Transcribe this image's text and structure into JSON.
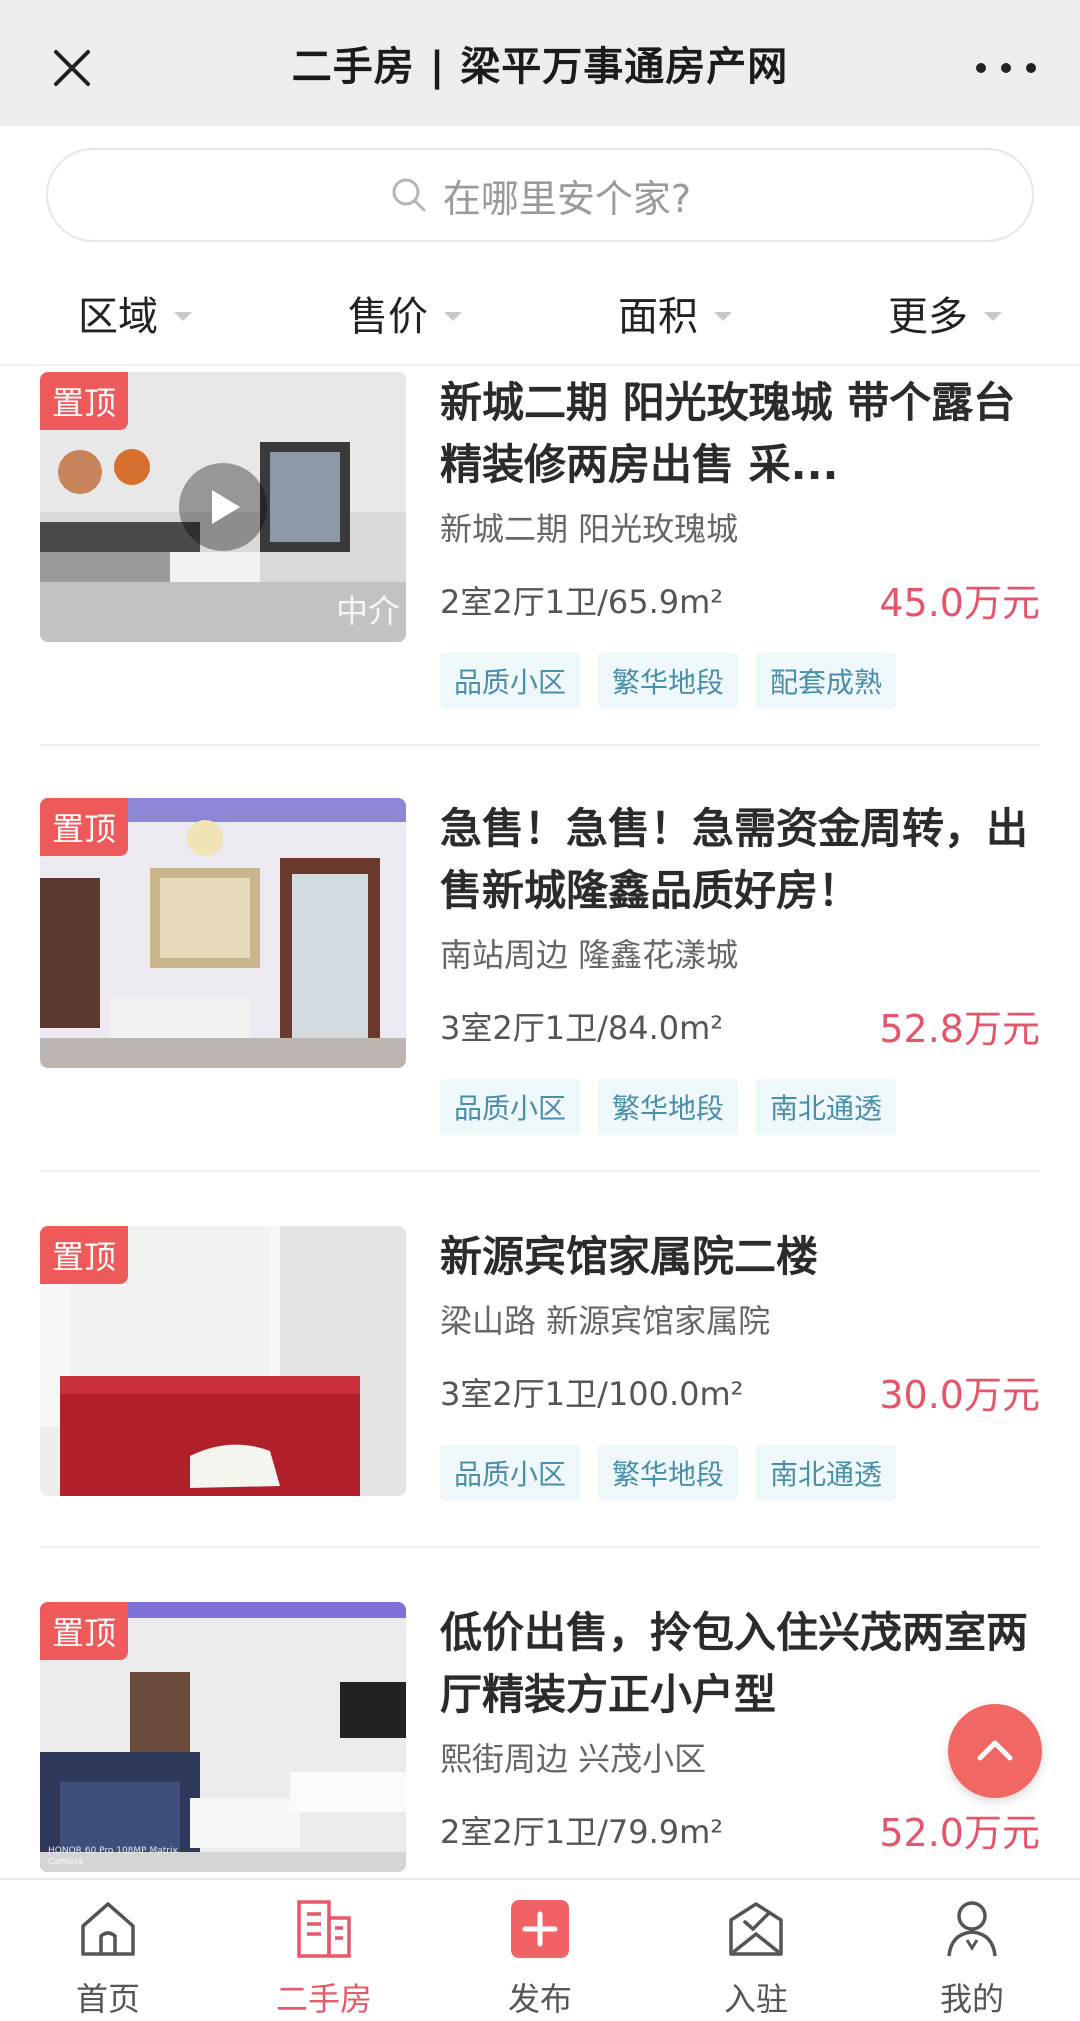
{
  "header": {
    "title": "二手房 | 梁平万事通房产网"
  },
  "search": {
    "placeholder": "在哪里安个家?"
  },
  "filters": [
    {
      "label": "区域"
    },
    {
      "label": "售价"
    },
    {
      "label": "面积"
    },
    {
      "label": "更多"
    }
  ],
  "listings": [
    {
      "badge": "置顶",
      "title": "新城二期 阳光玫瑰城 带个露台精装修两房出售 采...",
      "address": "新城二期 阳光玫瑰城",
      "spec": "2室2厅1卫/65.9m²",
      "price": "45.0万元",
      "tags": [
        "品质小区",
        "繁华地段",
        "配套成熟"
      ],
      "watermark": "中介"
    },
    {
      "badge": "置顶",
      "title": "急售！急售！急需资金周转，出售新城隆鑫品质好房！",
      "address": "南站周边 隆鑫花漾城",
      "spec": "3室2厅1卫/84.0m²",
      "price": "52.8万元",
      "tags": [
        "品质小区",
        "繁华地段",
        "南北通透"
      ]
    },
    {
      "badge": "置顶",
      "title": "新源宾馆家属院二楼",
      "address": "梁山路 新源宾馆家属院",
      "spec": "3室2厅1卫/100.0m²",
      "price": "30.0万元",
      "tags": [
        "品质小区",
        "繁华地段",
        "南北通透"
      ]
    },
    {
      "badge": "置顶",
      "title": "低价出售，拎包入住兴茂两室两厅精装方正小户型",
      "address": "熙街周边 兴茂小区",
      "spec": "2室2厅1卫/79.9m²",
      "price": "52.0万元",
      "tags": [],
      "watermark": "HONOR 60 Pro 108MP Matrix Camera"
    }
  ],
  "tabbar": [
    {
      "label": "首页",
      "icon": "home-icon"
    },
    {
      "label": "二手房",
      "icon": "building-icon"
    },
    {
      "label": "发布",
      "icon": "plus-icon"
    },
    {
      "label": "入驻",
      "icon": "checkin-icon"
    },
    {
      "label": "我的",
      "icon": "user-icon"
    }
  ],
  "colors": {
    "accent": "#e5596a",
    "price": "#e3556a",
    "badge": "#ee5a5a",
    "tag_bg": "#eef7f9",
    "tag_text": "#4a8ea8"
  }
}
